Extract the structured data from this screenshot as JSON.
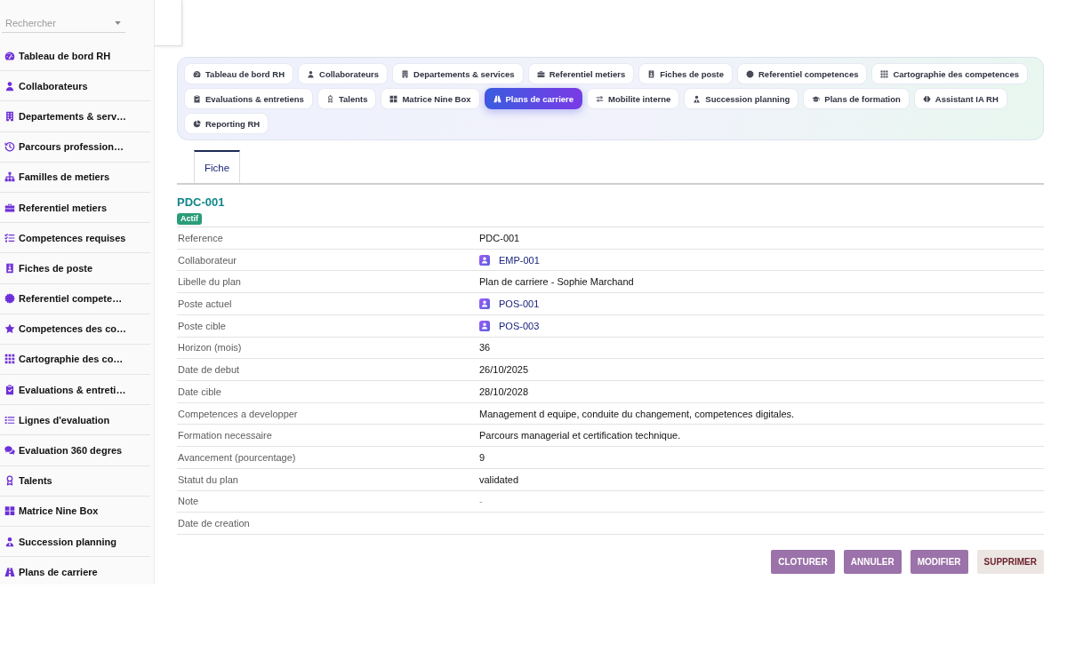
{
  "sidebar": {
    "search": {
      "placeholder": "Rechercher"
    },
    "items": [
      {
        "label": "Tableau de bord RH"
      },
      {
        "label": "Collaborateurs"
      },
      {
        "label": "Departements & serv…"
      },
      {
        "label": "Parcours profession…"
      },
      {
        "label": "Familles de metiers"
      },
      {
        "label": "Referentiel metiers"
      },
      {
        "label": "Competences requises"
      },
      {
        "label": "Fiches de poste"
      },
      {
        "label": "Referentiel compete…"
      },
      {
        "label": "Competences des co…"
      },
      {
        "label": "Cartographie des co…"
      },
      {
        "label": "Evaluations & entreti…"
      },
      {
        "label": "Lignes d'evaluation"
      },
      {
        "label": "Evaluation 360 degres"
      },
      {
        "label": "Talents"
      },
      {
        "label": "Matrice Nine Box"
      },
      {
        "label": "Succession planning"
      },
      {
        "label": "Plans de carriere"
      }
    ]
  },
  "module_tabs": [
    {
      "label": "Tableau de bord RH",
      "selected": false
    },
    {
      "label": "Collaborateurs",
      "selected": false
    },
    {
      "label": "Departements & services",
      "selected": false
    },
    {
      "label": "Referentiel metiers",
      "selected": false
    },
    {
      "label": "Fiches de poste",
      "selected": false
    },
    {
      "label": "Referentiel competences",
      "selected": false
    },
    {
      "label": "Cartographie des competences",
      "selected": false
    },
    {
      "label": "Evaluations & entretiens",
      "selected": false
    },
    {
      "label": "Talents",
      "selected": false
    },
    {
      "label": "Matrice Nine Box",
      "selected": false
    },
    {
      "label": "Plans de carriere",
      "selected": true
    },
    {
      "label": "Mobilite interne",
      "selected": false
    },
    {
      "label": "Succession planning",
      "selected": false
    },
    {
      "label": "Plans de formation",
      "selected": false
    },
    {
      "label": "Assistant IA RH",
      "selected": false
    },
    {
      "label": "Reporting RH",
      "selected": false
    }
  ],
  "record": {
    "tabs": [
      {
        "label": "Fiche",
        "selected": true
      }
    ],
    "title": "PDC-001",
    "status": "Actif",
    "fields": [
      {
        "label": "Reference",
        "value": "PDC-001",
        "kind": "text"
      },
      {
        "label": "Collaborateur",
        "value": "EMP-001",
        "kind": "link"
      },
      {
        "label": "Libelle du plan",
        "value": "Plan de carriere - Sophie Marchand",
        "kind": "text"
      },
      {
        "label": "Poste actuel",
        "value": "POS-001",
        "kind": "link"
      },
      {
        "label": "Poste cible",
        "value": "POS-003",
        "kind": "link"
      },
      {
        "label": "Horizon (mois)",
        "value": "36",
        "kind": "text"
      },
      {
        "label": "Date de debut",
        "value": "26/10/2025",
        "kind": "text"
      },
      {
        "label": "Date cible",
        "value": "28/10/2028",
        "kind": "text"
      },
      {
        "label": "Competences a developper",
        "value": "Management d equipe, conduite du changement, competences digitales.",
        "kind": "text"
      },
      {
        "label": "Formation necessaire",
        "value": "Parcours managerial et certification technique.",
        "kind": "text"
      },
      {
        "label": "Avancement (pourcentage)",
        "value": "9",
        "kind": "text"
      },
      {
        "label": "Statut du plan",
        "value": "validated",
        "kind": "text"
      },
      {
        "label": "Note",
        "value": "-",
        "kind": "muted"
      },
      {
        "label": "Date de creation",
        "kind": "text"
      }
    ]
  },
  "actions": [
    {
      "label": "CLOTURER",
      "kind": "primary"
    },
    {
      "label": "ANNULER",
      "kind": "primary"
    },
    {
      "label": "MODIFIER",
      "kind": "primary"
    },
    {
      "label": "SUPPRIMER",
      "kind": "danger"
    }
  ]
}
